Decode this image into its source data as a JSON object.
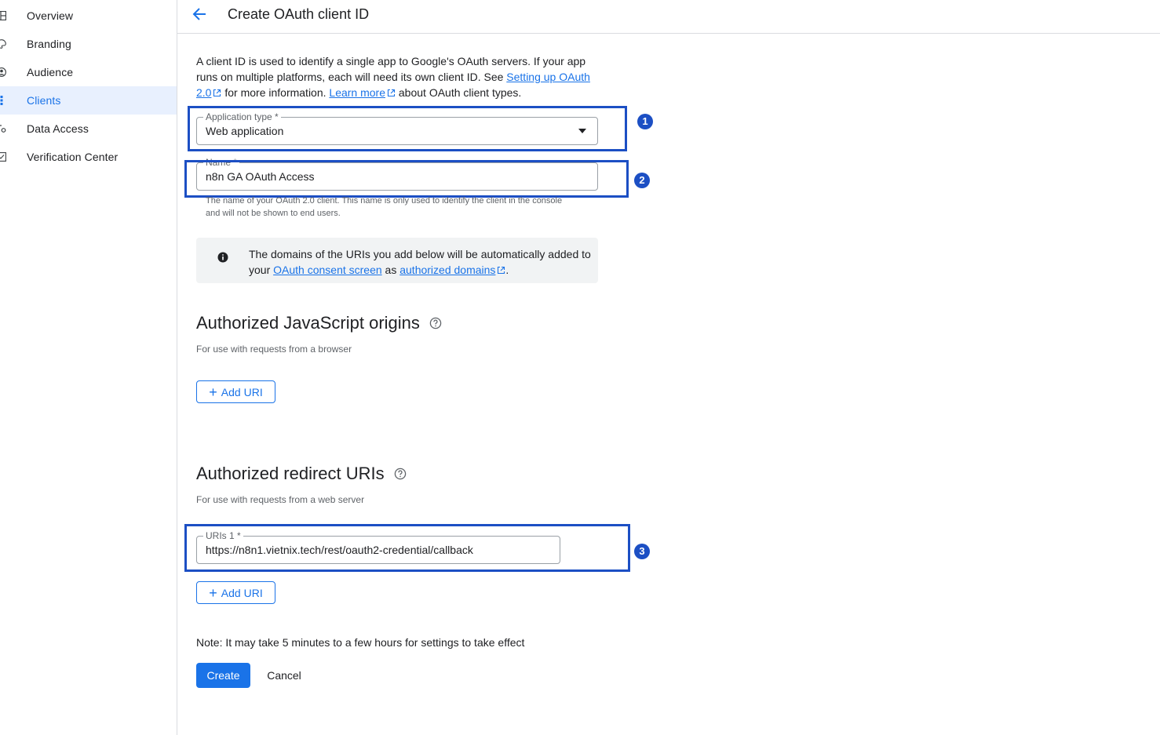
{
  "sidebar": {
    "items": [
      {
        "label": "Overview",
        "icon": "dashboard-icon",
        "active": false
      },
      {
        "label": "Branding",
        "icon": "palette-icon",
        "active": false
      },
      {
        "label": "Audience",
        "icon": "person-icon",
        "active": false
      },
      {
        "label": "Clients",
        "icon": "grid-icon",
        "active": true
      },
      {
        "label": "Data Access",
        "icon": "settings-icon",
        "active": false
      },
      {
        "label": "Verification Center",
        "icon": "checkbox-icon",
        "active": false
      }
    ]
  },
  "header": {
    "title": "Create OAuth client ID"
  },
  "intro": {
    "text1": "A client ID is used to identify a single app to Google's OAuth servers. If your app runs on multiple platforms, each will need its own client ID. See ",
    "link1": "Setting up OAuth 2.0",
    "text2": " for more information. ",
    "link2": "Learn more",
    "text3": " about OAuth client types."
  },
  "form": {
    "app_type": {
      "label": "Application type *",
      "value": "Web application"
    },
    "name": {
      "label": "Name *",
      "value": "n8n GA OAuth Access",
      "hint": "The name of your OAuth 2.0 client. This name is only used to identify the client in the console and will not be shown to end users."
    }
  },
  "info_box": {
    "text1": "The domains of the URIs you add below will be automatically added to your ",
    "link1": "OAuth consent screen",
    "text2": " as ",
    "link2": "authorized domains",
    "text3": "."
  },
  "js_origins": {
    "title": "Authorized JavaScript origins",
    "subtitle": "For use with requests from a browser",
    "add_label": "Add URI"
  },
  "redirect_uris": {
    "title": "Authorized redirect URIs",
    "subtitle": "For use with requests from a web server",
    "uri_label": "URIs 1 *",
    "uri_value": "https://n8n1.vietnix.tech/rest/oauth2-credential/callback",
    "add_label": "Add URI"
  },
  "annotations": {
    "badge1": "1",
    "badge2": "2",
    "badge3": "3",
    "color": "#1c4fc4"
  },
  "footer": {
    "note": "Note: It may take 5 minutes to a few hours for settings to take effect",
    "create_label": "Create",
    "cancel_label": "Cancel"
  },
  "colors": {
    "accent": "#1a73e8",
    "active_bg": "#e8f0fe"
  }
}
